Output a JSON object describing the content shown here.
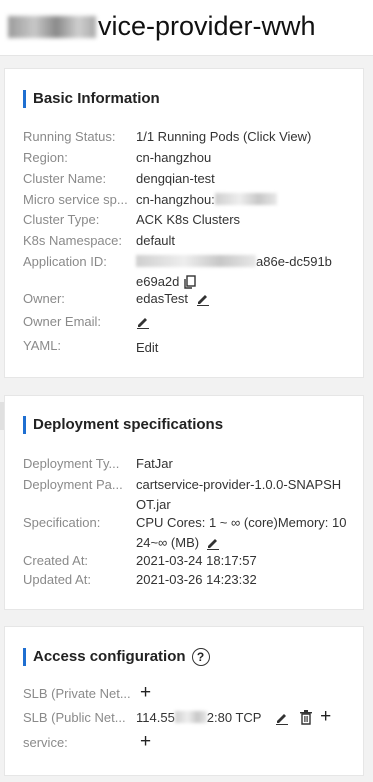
{
  "app": {
    "title_visible": "vice-provider-wwh"
  },
  "basic": {
    "title": "Basic Information",
    "running_status_label": "Running Status:",
    "running_status_value": "1/1 Running Pods (Click View)",
    "region_label": "Region:",
    "region_value": "cn-hangzhou",
    "cluster_name_label": "Cluster Name:",
    "cluster_name_value": "dengqian-test",
    "micro_label": "Micro service sp...",
    "micro_value_visible": "cn-hangzhou:",
    "cluster_type_label": "Cluster Type:",
    "cluster_type_value": "ACK K8s Clusters",
    "namespace_label": "K8s Namespace:",
    "namespace_value": "default",
    "app_id_label": "Application ID:",
    "app_id_value_visible_1": "a86e-dc591b",
    "app_id_value_visible_2": "e69a2d",
    "owner_label": "Owner:",
    "owner_value": "edasTest",
    "owner_email_label": "Owner Email:",
    "yaml_label": "YAML:",
    "yaml_link": "Edit"
  },
  "deploy": {
    "title": "Deployment specifications",
    "type_label": "Deployment Ty...",
    "type_value": "FatJar",
    "package_label": "Deployment Pa...",
    "package_value": "cartservice-provider-1.0.0-SNAPSHOT.jar",
    "spec_label": "Specification:",
    "spec_value": "CPU Cores: 1 ~ ∞ (core)Memory: 1024~∞ (MB)",
    "created_label": "Created At:",
    "created_value": "2021-03-24 18:17:57",
    "updated_label": "Updated At:",
    "updated_value": "2021-03-26 14:23:32"
  },
  "access": {
    "title": "Access configuration",
    "help": "?",
    "slb_private_label": "SLB (Private Net...",
    "slb_public_label": "SLB (Public Net...",
    "slb_public_value_prefix": "114.55",
    "slb_public_value_suffix": "2:80 TCP",
    "service_label": "service:",
    "plus": "+"
  }
}
